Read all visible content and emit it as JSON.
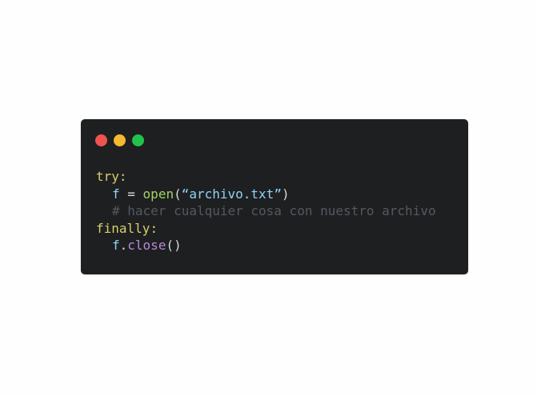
{
  "colors": {
    "background": "#fefefe",
    "window_background": "#1e1f21",
    "light_close": "#ef5350",
    "light_minimize": "#f5b82e",
    "light_maximize": "#22c34a",
    "keyword": "#d8cf6a",
    "identifier": "#8fd3f5",
    "operator": "#d6dade",
    "function": "#a4d36a",
    "paren": "#d6dade",
    "string": "#8fd3f5",
    "comment": "#535960",
    "method": "#b48ad8"
  },
  "code": {
    "line1": {
      "keyword": "try",
      "colon": ":"
    },
    "line2": {
      "var": "f",
      "assign": " = ",
      "func": "open",
      "open_paren": "(",
      "string": "“archivo.txt”",
      "close_paren": ")"
    },
    "line3": {
      "comment": "# hacer cualquier cosa con nuestro archivo"
    },
    "line4": {
      "keyword": "finally",
      "colon": ":"
    },
    "line5": {
      "var": "f",
      "dot": ".",
      "method": "close",
      "parens": "()"
    }
  }
}
